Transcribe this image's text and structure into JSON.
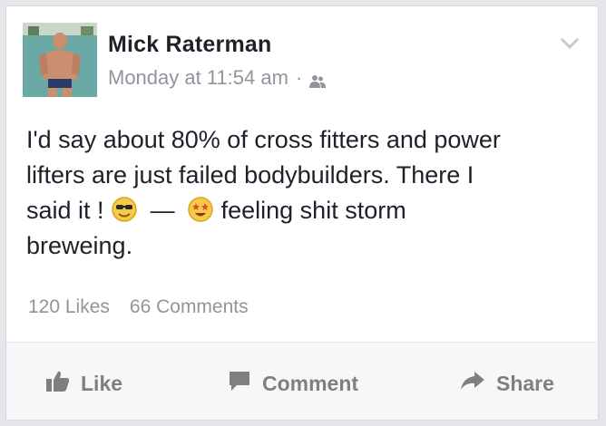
{
  "post": {
    "author": "Mick Raterman",
    "timestamp": "Monday at 11:54 am",
    "separator": "·",
    "privacy_icon": "friends-icon",
    "text_line1": "I'd say about 80% of cross fitters and power",
    "text_line2": "lifters are just failed bodybuilders. There I",
    "text_said": "said it !",
    "dash": "—",
    "feeling_text": "feeling shit storm",
    "text_last": "breweing.",
    "emoji_1": "sunglasses-emoji",
    "emoji_2": "star-struck-emoji"
  },
  "stats": {
    "likes": "120 Likes",
    "comments": "66 Comments"
  },
  "actions": {
    "like": "Like",
    "comment": "Comment",
    "share": "Share"
  },
  "colors": {
    "author": "#1d2129",
    "meta": "#90949c",
    "action": "#7f7f7f",
    "footer_bg": "#f6f7f9"
  }
}
